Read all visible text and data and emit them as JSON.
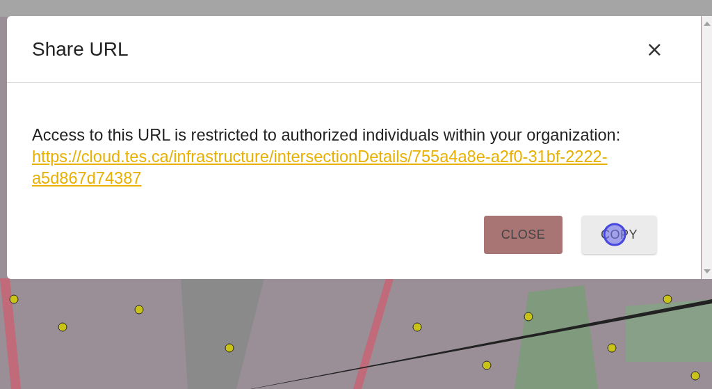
{
  "dialog": {
    "title": "Share URL",
    "close_icon": "×",
    "message": "Access to this URL is restricted to authorized individuals within your organization:",
    "link": "https://cloud.tes.ca/infrastructure/intersectionDetails/755a4a8e-a2f0-31bf-2222-a5d867d74387",
    "buttons": [
      {
        "label": "CLOSE",
        "kind": "secondary"
      },
      {
        "label": "COPY",
        "kind": "primary"
      }
    ]
  }
}
